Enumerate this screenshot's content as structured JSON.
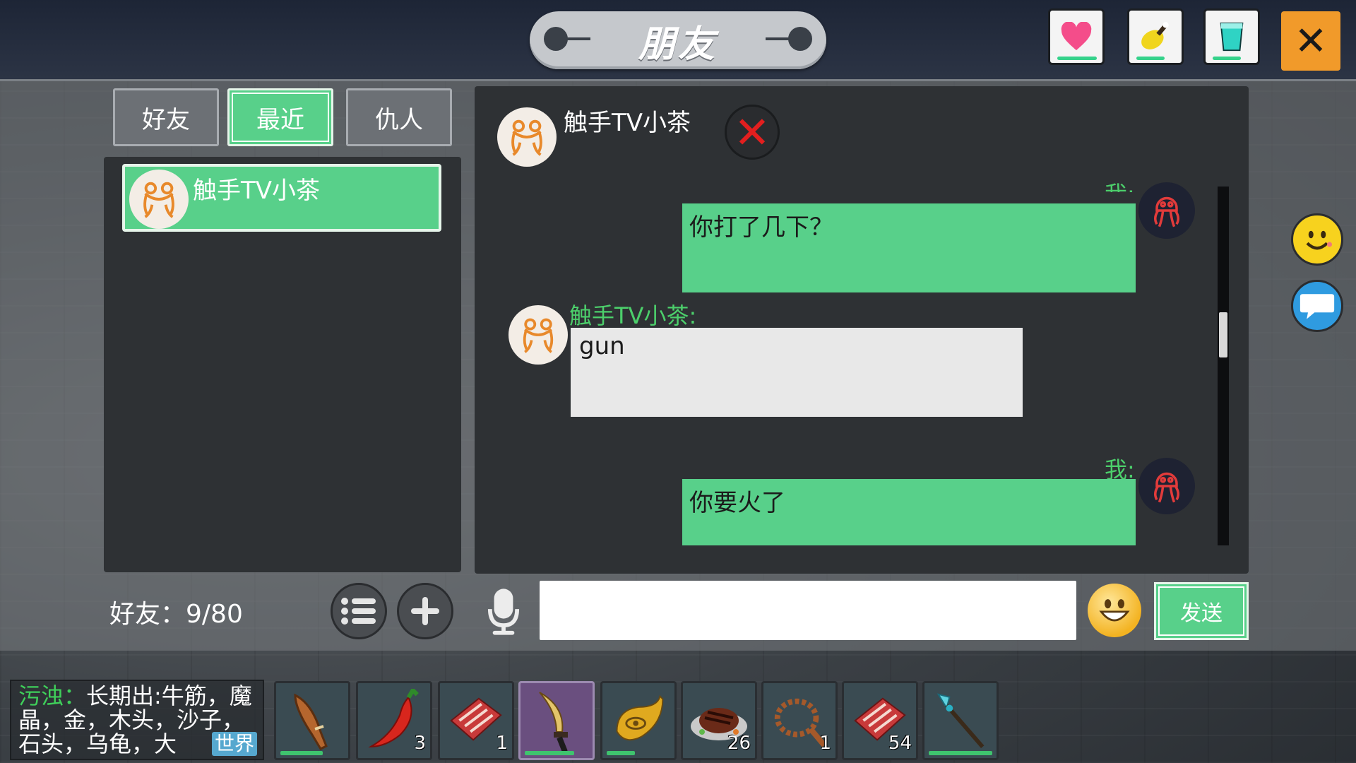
{
  "window": {
    "title": "朋友",
    "close_icon": "close-icon"
  },
  "status_bar": {
    "health": {
      "icon": "heart-icon",
      "color": "#f44d8a",
      "level": 0.9
    },
    "hunger": {
      "icon": "drumstick-icon",
      "color": "#f0d51e",
      "level": 0.6
    },
    "thirst": {
      "icon": "water-cup-icon",
      "color": "#2fd3c4",
      "level": 0.6
    }
  },
  "tabs": [
    {
      "label": "好友",
      "active": false
    },
    {
      "label": "最近",
      "active": true
    },
    {
      "label": "仇人",
      "active": false
    }
  ],
  "friend_list": [
    {
      "name": "触手TV小茶",
      "avatar": "frog-avatar",
      "selected": true
    }
  ],
  "friend_count": "好友：9/80",
  "list_buttons": {
    "menu_icon": "list-icon",
    "add_icon": "plus-icon"
  },
  "chat": {
    "partner_name": "触手TV小茶",
    "messages": [
      {
        "from": "me",
        "label": "我:",
        "text": "你打了几下？"
      },
      {
        "from": "other",
        "label": "触手TV小茶:",
        "text": "gun"
      },
      {
        "from": "me",
        "label": "我:",
        "text": "你要火了"
      }
    ],
    "input_value": "",
    "send_label": "发送"
  },
  "side_buttons": [
    {
      "icon": "smiley-icon",
      "color": "#f7d21e"
    },
    {
      "icon": "chat-bubble-icon",
      "color": "#2f9be0"
    }
  ],
  "log": {
    "tag": "污浊：",
    "text": "长期出:牛筋，魔晶，金，木头，沙子，石头，乌龟，大",
    "channel": "世界"
  },
  "hotbar": [
    {
      "item": "wooden-club",
      "count": "",
      "durability": 0.6
    },
    {
      "item": "red-pepper",
      "count": "3",
      "durability": 0
    },
    {
      "item": "raw-bacon",
      "count": "1",
      "durability": 0
    },
    {
      "item": "curved-dagger",
      "count": "",
      "durability": 0.7,
      "selected": true
    },
    {
      "item": "golden-horn",
      "count": "",
      "durability": 0.4
    },
    {
      "item": "grilled-steak",
      "count": "26",
      "durability": 0
    },
    {
      "item": "rope",
      "count": "1",
      "durability": 0
    },
    {
      "item": "raw-bacon",
      "count": "54",
      "durability": 0
    },
    {
      "item": "crystal-spear",
      "count": "",
      "durability": 0.9
    }
  ]
}
